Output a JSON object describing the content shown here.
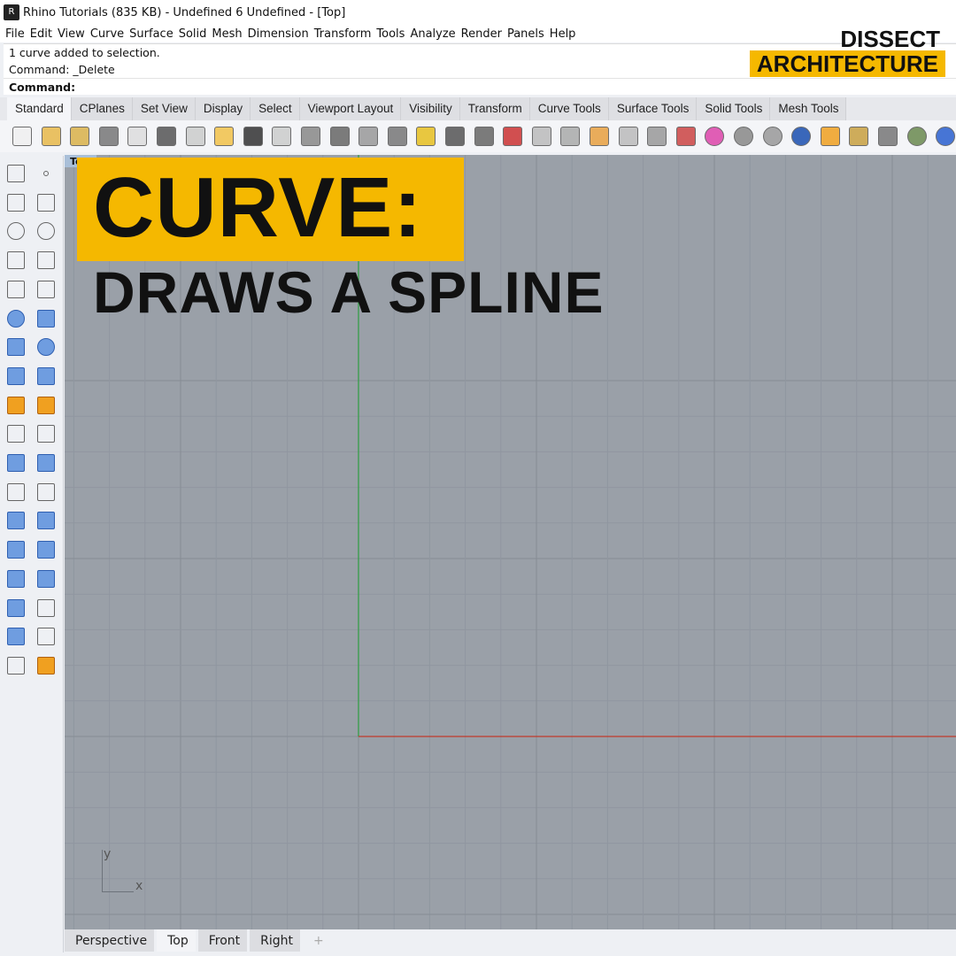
{
  "window": {
    "title": "Rhino Tutorials (835 KB) - Undefined 6 Undefined - [Top]",
    "app_icon": "rhino-icon"
  },
  "menu": [
    "File",
    "Edit",
    "View",
    "Curve",
    "Surface",
    "Solid",
    "Mesh",
    "Dimension",
    "Transform",
    "Tools",
    "Analyze",
    "Render",
    "Panels",
    "Help"
  ],
  "command_history": [
    "1 curve added to selection.",
    "Command: _Delete"
  ],
  "command_prompt": "Command:",
  "brand": {
    "line1": "DISSECT",
    "line2": "ARCHITECTURE",
    "accent": "#f5b800"
  },
  "toolbar_tabs": [
    "Standard",
    "CPlanes",
    "Set View",
    "Display",
    "Select",
    "Viewport Layout",
    "Visibility",
    "Transform",
    "Curve Tools",
    "Surface Tools",
    "Solid Tools",
    "Mesh Tools"
  ],
  "active_toolbar_tab": "Standard",
  "toolbar_icons": [
    "new-icon",
    "open-icon",
    "save-icon",
    "print-icon",
    "import-icon",
    "cut-icon",
    "copy-icon",
    "paste-icon",
    "undo-icon",
    "pan-icon",
    "rotate-view-icon",
    "zoom-icon",
    "zoom-window-icon",
    "zoom-extents-icon",
    "zoom-selected-icon",
    "undo-view-icon",
    "four-viewports-icon",
    "car-render-icon",
    "cplane-icon",
    "distance-icon",
    "block-icon",
    "light-icon",
    "lock-icon",
    "layer-icon",
    "color-wheel-icon",
    "shaded-sphere-icon",
    "grid-sphere-icon",
    "rendered-sphere-icon",
    "spotlight-icon",
    "options-gear-icon",
    "dimension-icon",
    "grasshopper-icon",
    "help-icon"
  ],
  "left_toolbar_icons": [
    "select-icon",
    "point-icon",
    "polyline-icon",
    "curve-icon",
    "circle-icon",
    "ellipse-icon",
    "arc-icon",
    "rectangle-icon",
    "polygon-icon",
    "fillet-curve-icon",
    "surface-from-points-icon",
    "extrude-surface-icon",
    "box-icon",
    "boolean-union-icon",
    "cylinder-icon",
    "mesh-surface-icon",
    "join-icon",
    "explode-icon",
    "trim-icon",
    "split-icon",
    "group-icon",
    "ungroup-icon",
    "curve-edit-icon",
    "curve-offset-icon",
    "text-icon",
    "move-icon",
    "array-icon",
    "orient-icon",
    "solid-edit-icon",
    "project-icon",
    "grid-array-icon",
    "align-icon",
    "flip-icon",
    "check-icon",
    "primitives-icon",
    "pyramid-icon"
  ],
  "viewport": {
    "label": "Top",
    "axis_x": "x",
    "axis_y": "y",
    "bg": "#9aa0a8",
    "x_axis_color": "#c0392b",
    "y_axis_color": "#2e9e40"
  },
  "viewport_tabs": [
    "Perspective",
    "Top",
    "Front",
    "Right"
  ],
  "active_viewport_tab": "Top",
  "add_viewport_icon": "plus-icon",
  "overlay": {
    "heading": "CURVE:",
    "subheading": "DRAWS A SPLINE"
  }
}
